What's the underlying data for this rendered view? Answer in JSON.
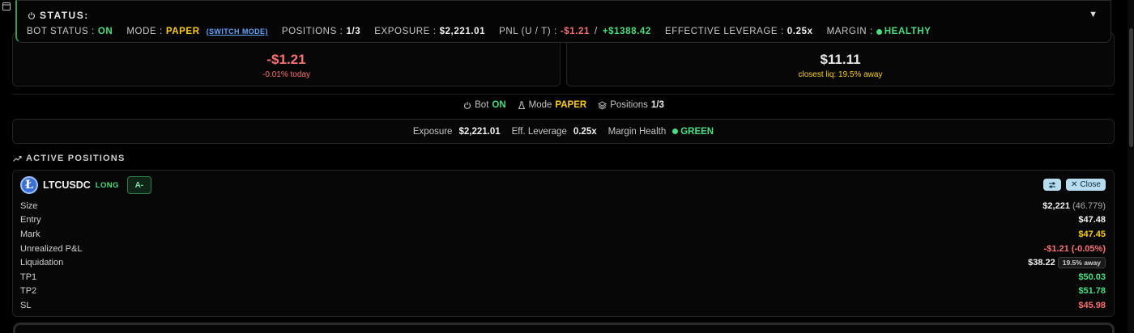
{
  "status": {
    "title": "STATUS:",
    "bot_status_label": "BOT STATUS :",
    "bot_status_value": "ON",
    "mode_label": "MODE :",
    "mode_value": "PAPER",
    "switch_mode": "(SWITCH MODE)",
    "positions_label": "POSITIONS :",
    "positions_value": "1/3",
    "exposure_label": "EXPOSURE :",
    "exposure_value": "$2,221.01",
    "pnl_label": "PNL (U / T) :",
    "pnl_unrealized": "-$1.21",
    "pnl_sep": "/",
    "pnl_total": "+$1388.42",
    "leverage_label": "EFFECTIVE LEVERAGE :",
    "leverage_value": "0.25x",
    "margin_label": "MARGIN :",
    "margin_value": "HEALTHY",
    "collapse_glyph": "▼"
  },
  "metrics": {
    "pnl_value": "-$1.21",
    "pnl_sub": "-0.01% today",
    "margin_value": "$11.11",
    "margin_sub": "closest liq: 19.5% away"
  },
  "summary": {
    "bot_label": "Bot",
    "bot_value": "ON",
    "mode_label": "Mode",
    "mode_value": "PAPER",
    "positions_label": "Positions",
    "positions_value": "1/3",
    "exposure_label": "Exposure",
    "exposure_value": "$2,221.01",
    "leverage_label": "Eff. Leverage",
    "leverage_value": "0.25x",
    "margin_label": "Margin Health",
    "margin_value": "GREEN"
  },
  "active_positions": {
    "title": "ACTIVE POSITIONS",
    "position": {
      "logo_glyph": "Ł",
      "symbol": "LTCUSDC",
      "side": "LONG",
      "grade": "A-",
      "close_label": "Close",
      "rows": {
        "size_label": "Size",
        "size_value": "$2,221",
        "size_qty": "(46.779)",
        "entry_label": "Entry",
        "entry_value": "$47.48",
        "mark_label": "Mark",
        "mark_value": "$47.45",
        "upnl_label": "Unrealized P&L",
        "upnl_value": "-$1.21 (-0.05%)",
        "liq_label": "Liquidation",
        "liq_value": "$38.22",
        "liq_pill": "19.5% away",
        "tp1_label": "TP1",
        "tp1_value": "$50.03",
        "tp2_label": "TP2",
        "tp2_value": "$51.78",
        "sl_label": "SL",
        "sl_value": "$45.98"
      }
    }
  },
  "colors": {
    "positive": "#4ade80",
    "warning": "#facc15",
    "negative": "#f87171",
    "link": "#60a5fa"
  }
}
